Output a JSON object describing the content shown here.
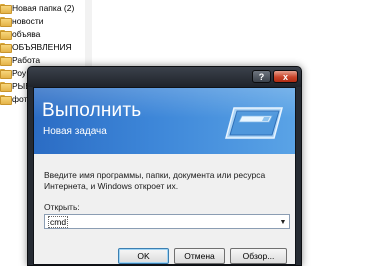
{
  "explorer": {
    "folders": [
      "Новая папка (2)",
      "новости",
      "объява",
      "ОБЪЯВЛЕНИЯ",
      "Работа",
      "Роу",
      "РЫБ",
      "фот"
    ]
  },
  "dialog": {
    "help_label": "?",
    "close_label": "x",
    "title": "Выполнить",
    "subtitle": "Новая задача",
    "instructions": "Введите имя программы, папки, документа или ресурса Интернета, и Windows откроет их.",
    "open_label": "Открыть:",
    "command_value": "cmd",
    "ok_label": "OK",
    "cancel_label": "Отмена",
    "browse_label": "Обзор..."
  },
  "colors": {
    "banner_start": "#2b6cc4",
    "banner_end": "#5aa3e6",
    "titlebar": "#262b33",
    "close_button": "#c9442a"
  }
}
